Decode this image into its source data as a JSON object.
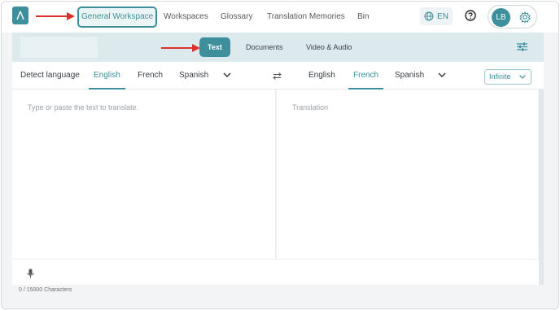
{
  "nav": {
    "items": [
      {
        "label": "General Workspace",
        "active": true
      },
      {
        "label": "Workspaces"
      },
      {
        "label": "Glossary"
      },
      {
        "label": "Translation Memories"
      },
      {
        "label": "Bin"
      }
    ],
    "language_code": "EN",
    "user_initials": "LB"
  },
  "toolbar": {
    "tabs": [
      {
        "label": "Text",
        "active": true
      },
      {
        "label": "Documents"
      },
      {
        "label": "Video & Audio"
      }
    ]
  },
  "source": {
    "detect_label": "Detect language",
    "languages": [
      "English",
      "French",
      "Spanish"
    ],
    "selected": "English",
    "placeholder": "Type or paste the text to translate."
  },
  "target": {
    "languages": [
      "English",
      "French",
      "Spanish"
    ],
    "selected": "French",
    "placeholder": "Translation",
    "model": "Infinite"
  },
  "footer": {
    "char_count": "0 / 15000 Characters"
  },
  "colors": {
    "accent": "#3d8f9b",
    "toolbar_bg": "#dceaee",
    "annotation_arrow": "#d9332b"
  }
}
